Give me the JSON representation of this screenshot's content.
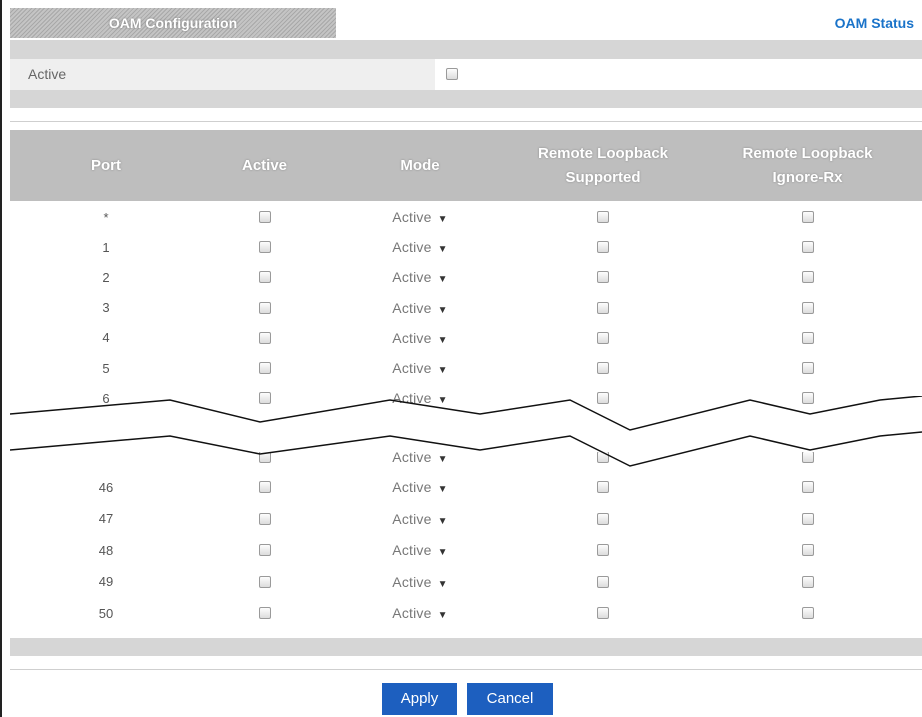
{
  "header": {
    "tab_label": "OAM Configuration",
    "status_link": "OAM Status"
  },
  "global": {
    "active_label": "Active",
    "active_checked": false
  },
  "table": {
    "columns": [
      "Port",
      "Active",
      "Mode",
      "Remote Loopback Supported",
      "Remote Loopback Ignore-Rx"
    ],
    "rows_top": [
      {
        "port": "*",
        "mode": "Active"
      },
      {
        "port": "1",
        "mode": "Active"
      },
      {
        "port": "2",
        "mode": "Active"
      },
      {
        "port": "3",
        "mode": "Active"
      },
      {
        "port": "4",
        "mode": "Active"
      },
      {
        "port": "5",
        "mode": "Active"
      },
      {
        "port": "6",
        "mode": "Active"
      }
    ],
    "row_after_break": {
      "port": "",
      "mode": "Active"
    },
    "rows_bottom": [
      {
        "port": "46",
        "mode": "Active"
      },
      {
        "port": "47",
        "mode": "Active"
      },
      {
        "port": "48",
        "mode": "Active"
      },
      {
        "port": "49",
        "mode": "Active"
      },
      {
        "port": "50",
        "mode": "Active"
      }
    ]
  },
  "buttons": {
    "apply": "Apply",
    "cancel": "Cancel"
  },
  "colors": {
    "button": "#1d5fbf",
    "link": "#1a73c9",
    "header_bar": "#bebebe"
  },
  "icons": {
    "dropdown": "triangle-down-icon",
    "checkbox": "checkbox-unchecked"
  }
}
